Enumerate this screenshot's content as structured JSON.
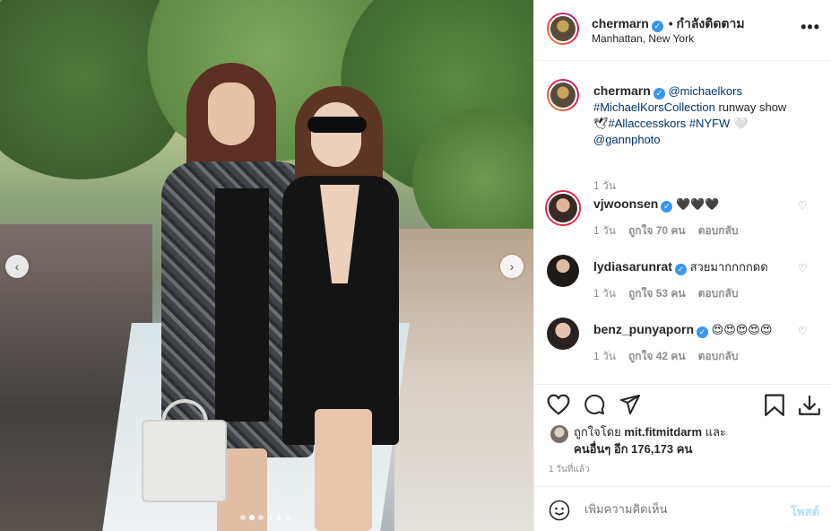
{
  "post": {
    "username": "chermarn",
    "follow_label": "• กำลังติดตาม",
    "location": "Manhattan, New York",
    "more_label": "•••"
  },
  "caption": {
    "username": "chermarn",
    "mention1": "@michaelkors",
    "hashtags1": "#MichaelKorsCollection",
    "text1": " runway show",
    "emoji1": "🕊",
    "hashtags2": "#Allaccesskors #NYFW",
    "emoji2": " 🤍",
    "mention2": "@gannphoto",
    "time": "1 วัน"
  },
  "comments": [
    {
      "username": "vjwoonsen",
      "text": "🖤🖤🖤",
      "time": "1 วัน",
      "likes": "ถูกใจ 70 คน",
      "reply": "ตอบกลับ"
    },
    {
      "username": "lydiasarunrat",
      "text": "สวยมากกกกดด",
      "time": "1 วัน",
      "likes": "ถูกใจ 53 คน",
      "reply": "ตอบกลับ"
    },
    {
      "username": "benz_punyaporn",
      "text": "😍😍😍😍😍",
      "time": "1 วัน",
      "likes": "ถูกใจ 42 คน",
      "reply": "ตอบกลับ"
    }
  ],
  "likes_line": {
    "prefix": "ถูกใจโดย ",
    "user": "mit.fitmitdarm",
    "mid": " และ",
    "others": "คนอื่นๆ อีก 176,173 คน"
  },
  "timestamp": "1 วันที่แล้ว",
  "add_comment": {
    "placeholder": "เพิ่มความคิดเห็น",
    "post_label": "โพสต์"
  },
  "carousel": {
    "prev": "‹",
    "next": "›",
    "total_slides": 6,
    "active_slide": 2
  },
  "icons": [
    "chevron-left-icon",
    "chevron-right-icon",
    "heart-icon",
    "comment-icon",
    "share-icon",
    "bookmark-icon",
    "download-icon",
    "emoji-icon",
    "verified-icon",
    "more-icon"
  ]
}
